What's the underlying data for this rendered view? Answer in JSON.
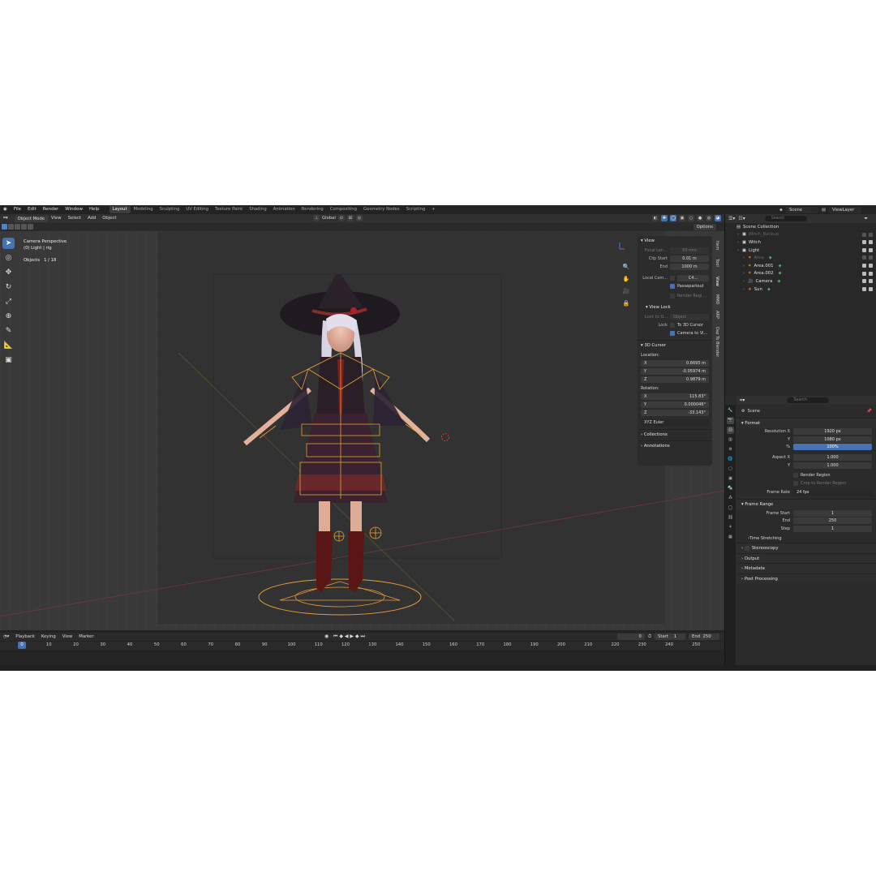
{
  "topbar": {
    "menus": [
      "File",
      "Edit",
      "Render",
      "Window",
      "Help"
    ],
    "workspaces": [
      "Layout",
      "Modeling",
      "Sculpting",
      "UV Editing",
      "Texture Paint",
      "Shading",
      "Animation",
      "Rendering",
      "Compositing",
      "Geometry Nodes",
      "Scripting"
    ],
    "active_workspace": "Layout",
    "scene": "Scene",
    "view_layer": "ViewLayer"
  },
  "header3d": {
    "mode": "Object Mode",
    "menus": [
      "View",
      "Select",
      "Add",
      "Object"
    ],
    "orientation": "Global",
    "options": "Options"
  },
  "viewport": {
    "camera_label": "Camera Perspective",
    "object_label": "(0) Light | rig",
    "objects_label": "Objects",
    "objects_count": "1 / 18"
  },
  "npanel": {
    "view_title": "View",
    "focal_length_label": "Focal Len...",
    "focal_length": "50 mm",
    "clip_start_label": "Clip Start",
    "clip_start": "0.01 m",
    "clip_end_label": "End",
    "clip_end": "1000 m",
    "local_camera_label": "Local Cam...",
    "local_camera": "C4...",
    "passepartout": "Passepartout",
    "render_region": "Render Regi...",
    "view_lock_title": "View Lock",
    "lock_to_object_label": "Lock to O...",
    "lock_to_object": "Object",
    "lock_label": "Lock",
    "to_3d_cursor": "To 3D Cursor",
    "camera_to_view": "Camera to Vi...",
    "cursor_title": "3D Cursor",
    "location_label": "Location:",
    "loc_x": "0.6695 m",
    "loc_y": "-0.05974 m",
    "loc_z": "0.9879 m",
    "rotation_label": "Rotation:",
    "rot_x": "115.83°",
    "rot_y": "0.000046°",
    "rot_z": "-33.143°",
    "rotation_mode": "XYZ Euler",
    "collections": "Collections",
    "annotations": "Annotations",
    "x": "X",
    "y": "Y",
    "z": "Z",
    "tabs": [
      "Item",
      "Tool",
      "View",
      "MMD",
      "ARP",
      "Daz To Blender"
    ]
  },
  "timeline": {
    "menus": [
      "Playback",
      "Keying",
      "View",
      "Marker"
    ],
    "current_frame": "0",
    "start_label": "Start",
    "start": "1",
    "end_label": "End",
    "end": "250",
    "ticks": [
      "0",
      "10",
      "20",
      "30",
      "40",
      "50",
      "60",
      "70",
      "80",
      "90",
      "100",
      "110",
      "120",
      "130",
      "140",
      "150",
      "160",
      "170",
      "180",
      "190",
      "200",
      "210",
      "220",
      "230",
      "240",
      "250"
    ]
  },
  "outliner": {
    "search_placeholder": "Search",
    "items": [
      {
        "label": "Scene Collection",
        "depth": 0
      },
      {
        "label": "Witch_Backup",
        "depth": 1,
        "dim": true
      },
      {
        "label": "Witch",
        "depth": 1
      },
      {
        "label": "Light",
        "depth": 1
      },
      {
        "label": "Area",
        "depth": 2,
        "dim": true
      },
      {
        "label": "Area.001",
        "depth": 2
      },
      {
        "label": "Area.002",
        "depth": 2
      },
      {
        "label": "Camera",
        "depth": 2
      },
      {
        "label": "Sun",
        "depth": 2
      }
    ]
  },
  "properties": {
    "search_placeholder": "Search",
    "scene": "Scene",
    "format_title": "Format",
    "res_x_label": "Resolution X",
    "res_x": "1920 px",
    "res_y_label": "Y",
    "res_y": "1080 px",
    "res_pct_label": "%",
    "res_pct": "100%",
    "aspect_x_label": "Aspect X",
    "aspect_x": "1.000",
    "aspect_y_label": "Y",
    "aspect_y": "1.000",
    "render_region": "Render Region",
    "crop_region": "Crop to Render Region",
    "frame_rate_label": "Frame Rate",
    "frame_rate": "24 fps",
    "frame_range_title": "Frame Range",
    "frame_start_label": "Frame Start",
    "frame_start": "1",
    "frame_end_label": "End",
    "frame_end": "250",
    "step_label": "Step",
    "step": "1",
    "time_stretching": "Time Stretching",
    "panels": [
      "Stereoscopy",
      "Output",
      "Metadata",
      "Post Processing"
    ]
  }
}
